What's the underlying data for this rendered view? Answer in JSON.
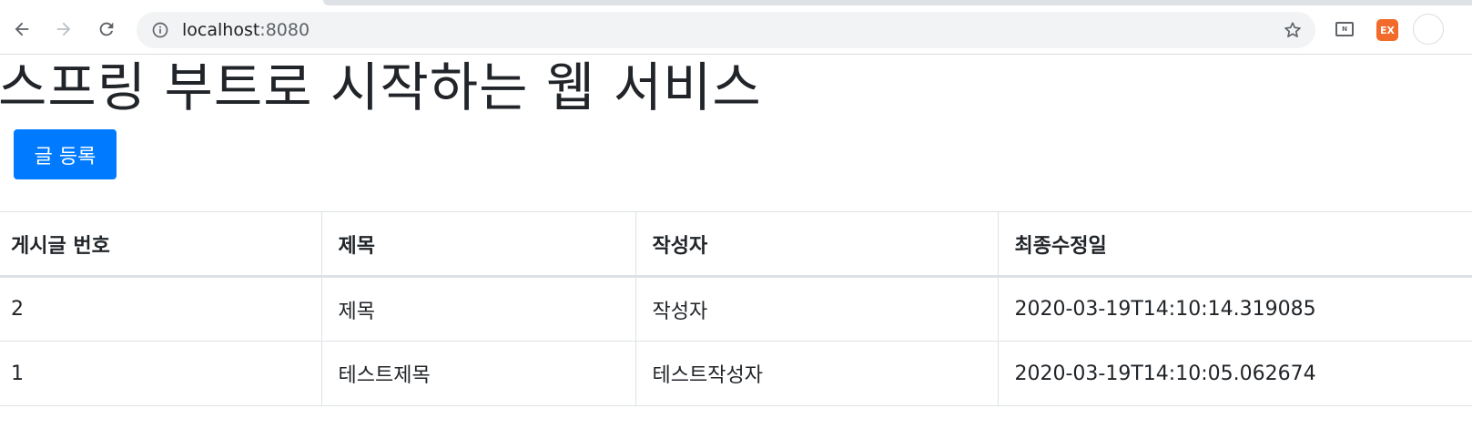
{
  "browser": {
    "url_host": "localhost",
    "url_port": ":8080",
    "extensions": [
      {
        "icon": "n-extension-icon",
        "label": "N"
      },
      {
        "icon": "ex-extension-icon",
        "label": "EX"
      }
    ],
    "colors": {
      "ex_extension": "#f26b2b"
    }
  },
  "page": {
    "title": "스프링 부트로 시작하는 웹 서비스",
    "register_button": "글 등록"
  },
  "table": {
    "headers": [
      "게시글 번호",
      "제목",
      "작성자",
      "최종수정일"
    ],
    "rows": [
      [
        "2",
        "제목",
        "작성자",
        "2020-03-19T14:10:14.319085"
      ],
      [
        "1",
        "테스트제목",
        "테스트작성자",
        "2020-03-19T14:10:05.062674"
      ]
    ]
  },
  "colors": {
    "primary": "#007bff"
  }
}
